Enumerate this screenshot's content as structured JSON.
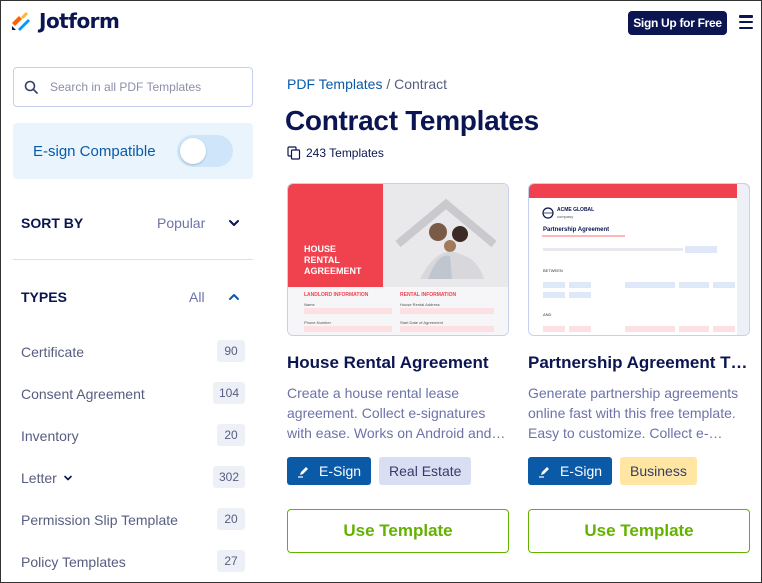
{
  "header": {
    "logo_text": "Jotform",
    "signup_label": "Sign Up for Free"
  },
  "sidebar": {
    "search_placeholder": "Search in all PDF Templates",
    "esign_label": "E-sign Compatible",
    "esign_enabled": false,
    "sort_title": "SORT BY",
    "sort_value": "Popular",
    "types_title": "TYPES",
    "types_filter": "All",
    "types": [
      {
        "label": "Certificate",
        "count": "90"
      },
      {
        "label": "Consent Agreement",
        "count": "104"
      },
      {
        "label": "Inventory",
        "count": "20"
      },
      {
        "label": "Letter",
        "count": "302"
      },
      {
        "label": "Permission Slip Template",
        "count": "20"
      },
      {
        "label": "Policy Templates",
        "count": "27"
      }
    ]
  },
  "main": {
    "breadcrumb": {
      "link": "PDF Templates",
      "separator": "/",
      "current": "Contract"
    },
    "title": "Contract Templates",
    "template_count": "243 Templates",
    "cards": [
      {
        "title": "House Rental Agreement",
        "description": "Create a house rental lease agreement. Collect e-signatures with ease. Works on Android and…",
        "tag1": "E-Sign",
        "tag2": "Real Estate",
        "button": "Use Template",
        "thumb": {
          "banner": "HOUSE RENTAL AGREEMENT",
          "section1": "LANDLORD INFORMATION",
          "section2": "RENTAL INFORMATION",
          "f1": "Name",
          "f2": "House Rental Address",
          "f3": "Phone Number",
          "f4": "Start Date of Agreement"
        }
      },
      {
        "title": "Partnership Agreement T…",
        "description": "Generate partnership agreements online fast with this free template. Easy to customize. Collect e-…",
        "tag1": "E-Sign",
        "tag2": "Business",
        "button": "Use Template",
        "thumb": {
          "company": "ACME GLOBAL",
          "company_sub": "company",
          "heading": "Partnership Agreement",
          "between": "BETWEEN",
          "and": "AND"
        }
      }
    ]
  },
  "colors": {
    "brand": "#0a1551",
    "accent_blue": "#0a5aa8",
    "green": "#64b200",
    "banner_red": "#f0414e"
  }
}
